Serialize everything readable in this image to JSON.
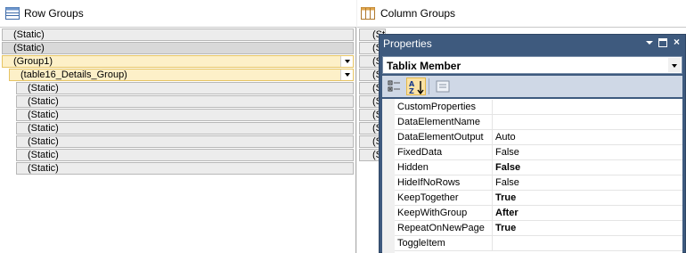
{
  "row_groups": {
    "title": "Row Groups",
    "items": [
      {
        "label": "(Static)"
      },
      {
        "label": "(Static)"
      },
      {
        "label": "(Group1)"
      },
      {
        "label": "(table16_Details_Group)"
      },
      {
        "label": "(Static)"
      },
      {
        "label": "(Static)"
      },
      {
        "label": "(Static)"
      },
      {
        "label": "(Static)"
      },
      {
        "label": "(Static)"
      },
      {
        "label": "(Static)"
      },
      {
        "label": "(Static)"
      }
    ]
  },
  "column_groups": {
    "title": "Column Groups",
    "items": [
      {
        "label": "(Static)"
      },
      {
        "label": "(Static)"
      },
      {
        "label": "(Static)"
      },
      {
        "label": "(Static)"
      },
      {
        "label": "(Static)"
      },
      {
        "label": "(Static)"
      },
      {
        "label": "(Static)"
      },
      {
        "label": "(Static)"
      },
      {
        "label": "(Static)"
      },
      {
        "label": "(Static)"
      }
    ]
  },
  "properties": {
    "title": "Properties",
    "object": "Tablix Member",
    "toolbar": {
      "categorized": "categorized-icon",
      "alphabetical": "alphabetical-sort-icon",
      "property_pages": "property-pages-icon"
    },
    "rows": [
      {
        "name": "CustomProperties",
        "value": ""
      },
      {
        "name": "DataElementName",
        "value": ""
      },
      {
        "name": "DataElementOutput",
        "value": "Auto"
      },
      {
        "name": "FixedData",
        "value": "False"
      },
      {
        "name": "Hidden",
        "value": "False"
      },
      {
        "name": "HideIfNoRows",
        "value": "False"
      },
      {
        "name": "KeepTogether",
        "value": "True"
      },
      {
        "name": "KeepWithGroup",
        "value": "After"
      },
      {
        "name": "RepeatOnNewPage",
        "value": "True"
      },
      {
        "name": "ToggleItem",
        "value": ""
      }
    ]
  },
  "colors": {
    "properties_frame": "#3e5a7e",
    "selected_group": "#fdf0c8",
    "selected_group_border": "#e6c464"
  }
}
